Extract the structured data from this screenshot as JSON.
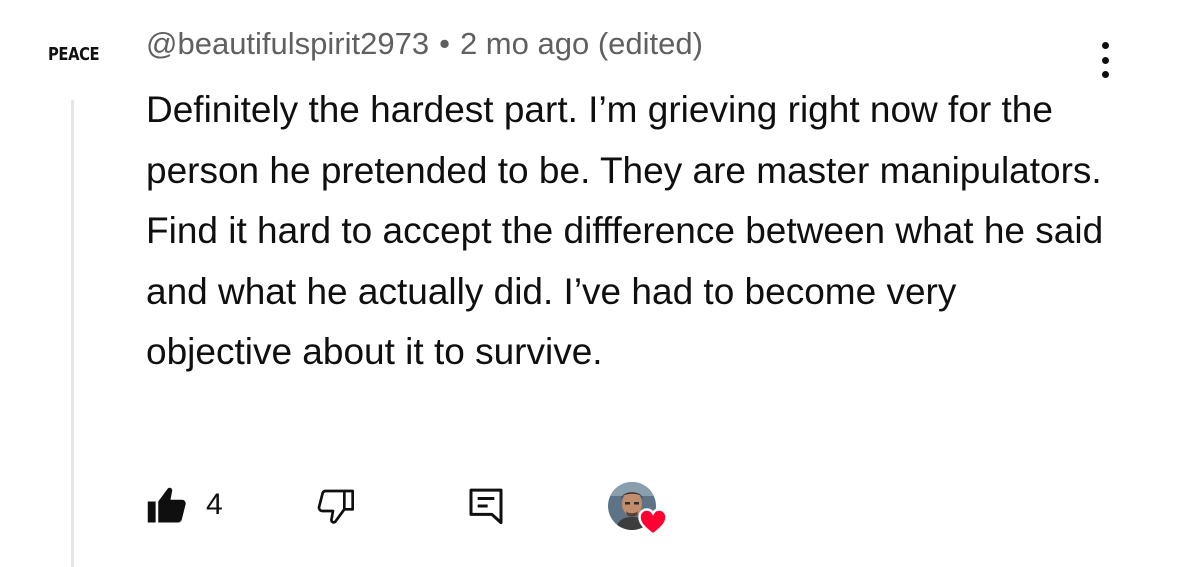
{
  "channel_avatar": {
    "text": "PEACE"
  },
  "comment": {
    "author": "@beautifulspirit2973",
    "separator": "•",
    "time": "2 mo ago (edited)",
    "text": "Definitely the hardest part. I’m grieving right now for the person he pretended to be. They are master manipulators. Find it hard to accept the diffference between what he said and what he actually did. I’ve had to become very objective about it to survive.",
    "like_count": "4"
  },
  "icons": {
    "menu": "more-vert-icon",
    "like": "thumbs-up-filled-icon",
    "dislike": "thumbs-down-outline-icon",
    "reply": "comment-reply-icon",
    "creator_heart": "heart-icon"
  },
  "colors": {
    "text": "#0f0f0f",
    "meta": "#606060",
    "heart": "#ff0033",
    "thread_line": "#e5e5e5"
  }
}
